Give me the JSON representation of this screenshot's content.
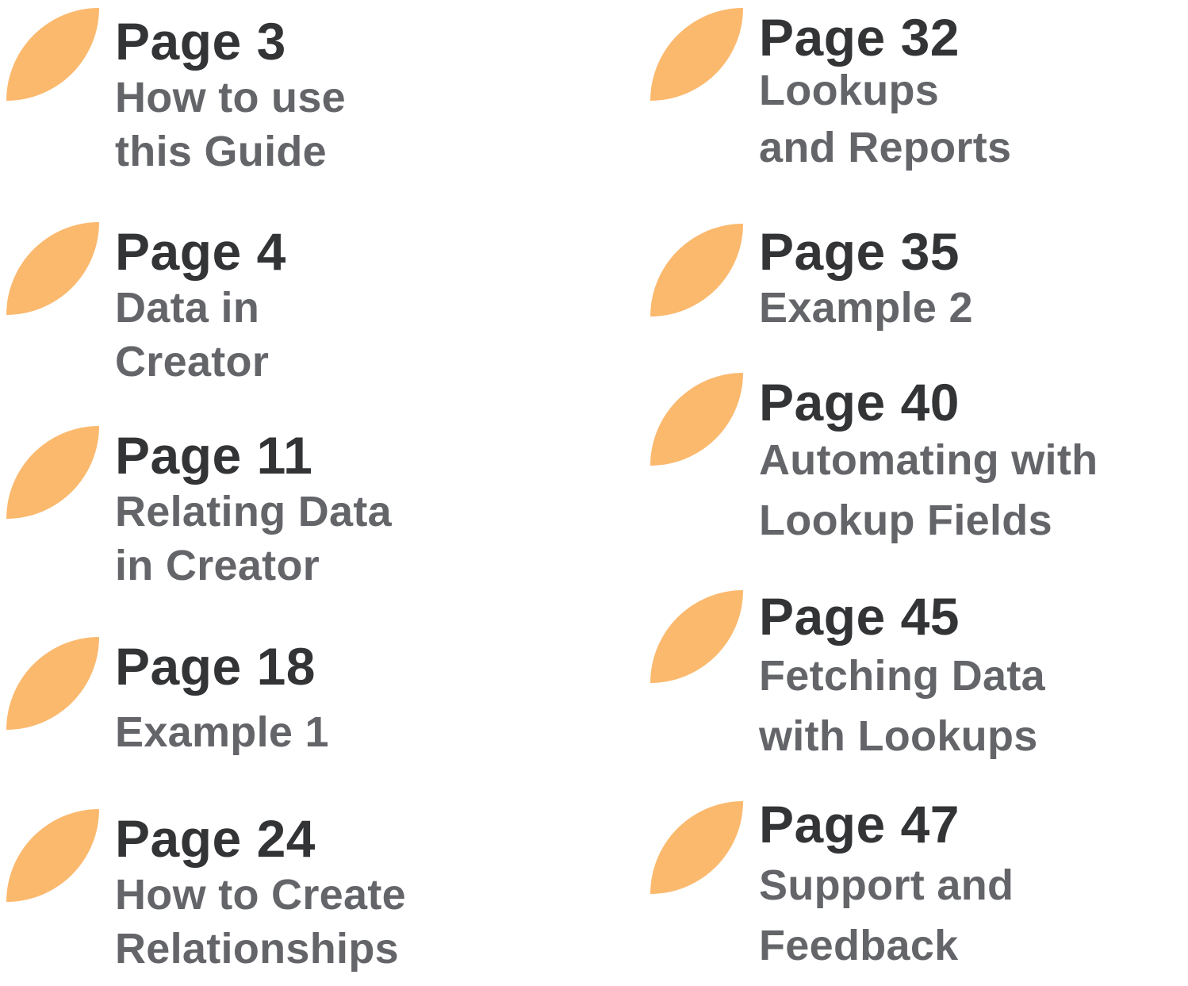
{
  "colors": {
    "leaf": "#fbb96e",
    "page_text": "#333436",
    "title_text": "#646569"
  },
  "icon": "leaf-bullet-icon",
  "toc": {
    "left": [
      {
        "page": "Page 3",
        "title_1": "How to use",
        "title_2": "this Guide"
      },
      {
        "page": "Page 4",
        "title_1": "Data in",
        "title_2": "Creator"
      },
      {
        "page": "Page 11",
        "title_1": "Relating Data",
        "title_2": "in Creator"
      },
      {
        "page": "Page 18",
        "title_1": "Example 1",
        "title_2": ""
      },
      {
        "page": "Page 24",
        "title_1": "How to Create",
        "title_2": "Relationships"
      }
    ],
    "right": [
      {
        "page": "Page 32",
        "title_1": "Lookups",
        "title_2": "and Reports"
      },
      {
        "page": "Page 35",
        "title_1": "Example 2",
        "title_2": ""
      },
      {
        "page": "Page 40",
        "title_1": "Automating with",
        "title_2": "Lookup Fields"
      },
      {
        "page": "Page 45",
        "title_1": "Fetching Data",
        "title_2": "with Lookups"
      },
      {
        "page": "Page 47",
        "title_1": "Support and",
        "title_2": "Feedback"
      }
    ]
  }
}
